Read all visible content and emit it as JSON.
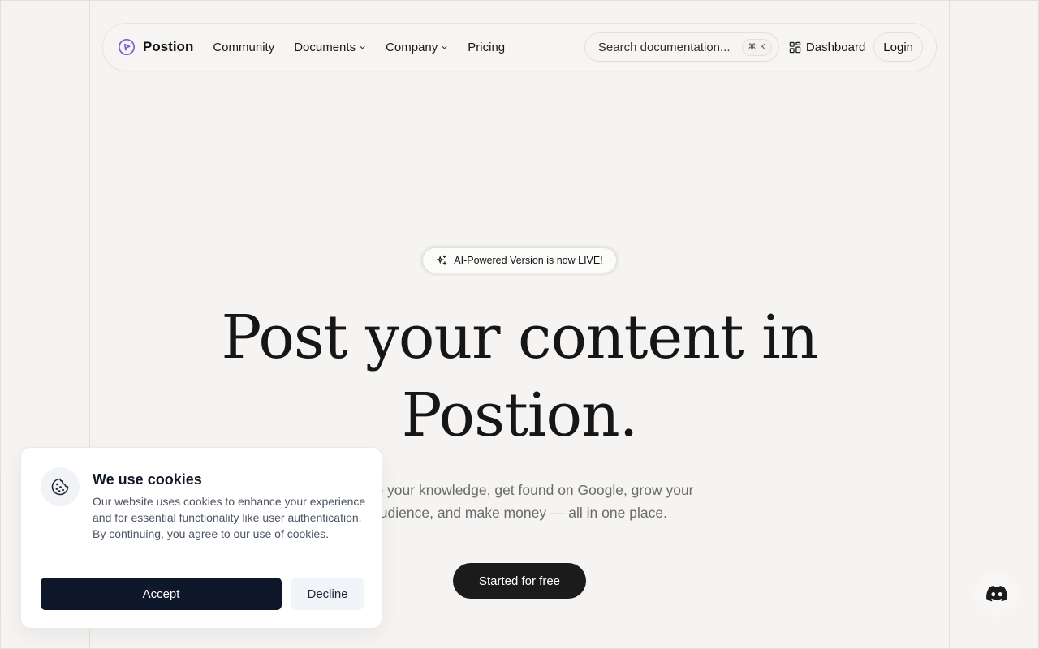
{
  "nav": {
    "brand": "Postion",
    "links": [
      {
        "label": "Community"
      },
      {
        "label": "Documents"
      },
      {
        "label": "Company"
      },
      {
        "label": "Pricing"
      }
    ],
    "search_placeholder": "Search documentation...",
    "search_shortcut": "⌘ K",
    "dashboard": "Dashboard",
    "login": "Login"
  },
  "hero": {
    "badge": "AI-Powered Version is now LIVE!",
    "title_line1": "Post your content in",
    "title_line2": "Postion.",
    "subtitle_line1": "Share your knowledge, get found on Google, grow your",
    "subtitle_line2": "audience, and make money — all in one place.",
    "cta": "Started for free"
  },
  "cookie": {
    "title": "We use cookies",
    "text": "Our website uses cookies to enhance your experience and for essential functionality like user authentication. By continuing, you agree to our use of cookies.",
    "accept": "Accept",
    "decline": "Decline"
  },
  "icons": {
    "brand": "play-circle-icon",
    "dashboard": "grid-icon",
    "badge": "sparkles-icon",
    "cookie": "cookie-icon",
    "floating": "discord-icon"
  },
  "colors": {
    "background": "#f5f4f2",
    "brand_accent": "#7c5cd6",
    "cta": "#1b1b1b",
    "accept": "#0f172a",
    "decline": "#f1f5f9"
  }
}
